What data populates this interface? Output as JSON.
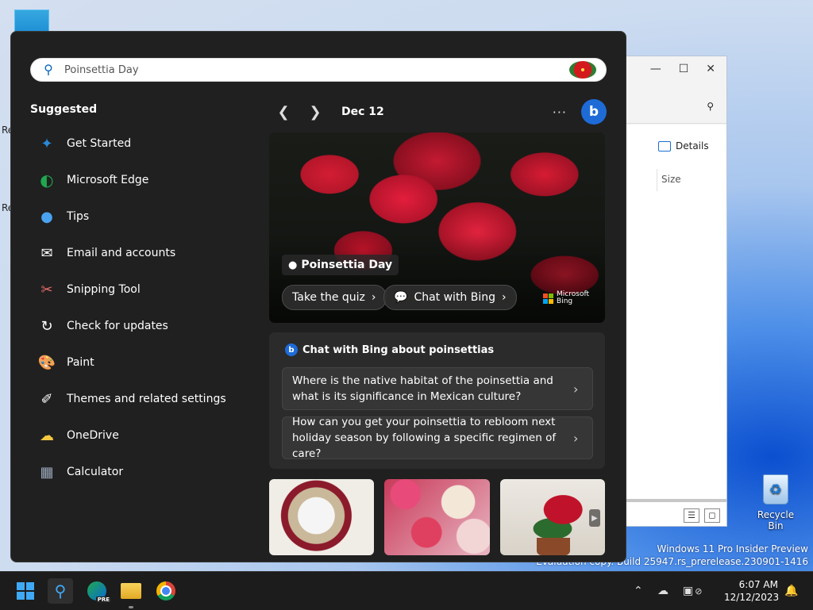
{
  "desktop": {
    "recycle_bin_label": "Recycle Bin",
    "edge_labels": [
      "Re",
      "Re"
    ],
    "watermark_line1": "Windows 11 Pro Insider Preview",
    "watermark_line2": "Evaluation copy. Build 25947.rs_prerelease.230901-1416"
  },
  "explorer": {
    "details_label": "Details",
    "size_column": "Size",
    "titlebar_icons": [
      "minimize-icon",
      "maximize-icon",
      "close-icon"
    ]
  },
  "search": {
    "value": "Poinsettia Day"
  },
  "suggested": {
    "title": "Suggested",
    "items": [
      {
        "label": "Get Started",
        "icon": "get-started-icon",
        "color": "#2b88d8"
      },
      {
        "label": "Microsoft Edge",
        "icon": "edge-icon",
        "color": "#1fa84f"
      },
      {
        "label": "Tips",
        "icon": "tips-icon",
        "color": "#4aa3f0"
      },
      {
        "label": "Email and accounts",
        "icon": "mail-icon",
        "color": "#ffffff"
      },
      {
        "label": "Snipping Tool",
        "icon": "snipping-tool-icon",
        "color": "#e86a6a"
      },
      {
        "label": "Check for updates",
        "icon": "refresh-icon",
        "color": "#ffffff"
      },
      {
        "label": "Paint",
        "icon": "paint-icon",
        "color": "#4ea0e8"
      },
      {
        "label": "Themes and related settings",
        "icon": "brush-icon",
        "color": "#ffffff"
      },
      {
        "label": "OneDrive",
        "icon": "onedrive-icon",
        "color": "#f5c842"
      },
      {
        "label": "Calculator",
        "icon": "calculator-icon",
        "color": "#9aa7b8"
      }
    ]
  },
  "highlights": {
    "date": "Dec 12",
    "more_label": "···",
    "bing_button": "b",
    "hero_title": "Poinsettia Day",
    "quiz_label": "Take the quiz",
    "chat_label": "Chat with Bing",
    "brand_line1": "Microsoft",
    "brand_line2": "Bing"
  },
  "chat": {
    "title": "Chat with Bing about poinsettias",
    "questions": [
      "Where is the native habitat of the poinsettia and what is its significance in Mexican culture?",
      "How can you get your poinsettia to rebloom next holiday season by following a specific regimen of care?"
    ]
  },
  "taskbar": {
    "apps": [
      "start-icon",
      "search-icon",
      "edge-beta-icon",
      "file-explorer-icon",
      "chrome-icon"
    ],
    "edge_badge": "PRE",
    "time": "6:07 AM",
    "date": "12/12/2023"
  },
  "colors": {
    "panel_bg": "#202020",
    "accent": "#1e6bd8",
    "hero_red": "#d31d34"
  }
}
